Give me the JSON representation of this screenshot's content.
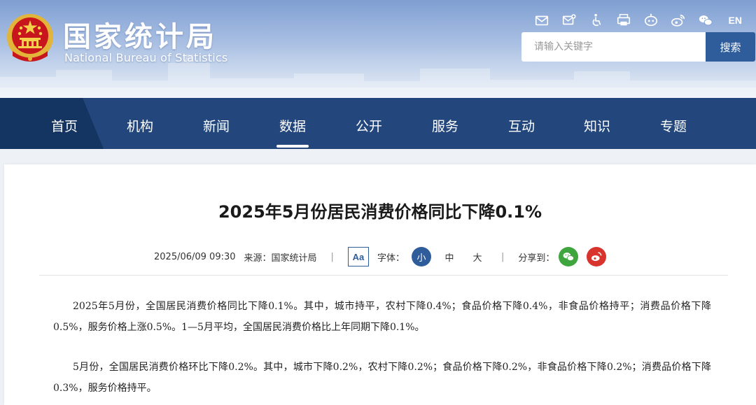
{
  "header": {
    "site_name_cn": "国家统计局",
    "site_name_en": "National Bureau of Statistics",
    "tools": [
      {
        "name": "mail-icon"
      },
      {
        "name": "subscribe-icon"
      },
      {
        "name": "accessibility-icon"
      },
      {
        "name": "print-icon"
      },
      {
        "name": "robot-icon"
      },
      {
        "name": "weibo-icon"
      },
      {
        "name": "wechat-icon"
      }
    ],
    "lang_label": "EN",
    "search": {
      "placeholder": "请输入关键字",
      "value": "",
      "button_label": "搜索"
    }
  },
  "nav": {
    "items": [
      {
        "label": "首页"
      },
      {
        "label": "机构"
      },
      {
        "label": "新闻"
      },
      {
        "label": "数据",
        "active": true
      },
      {
        "label": "公开"
      },
      {
        "label": "服务"
      },
      {
        "label": "互动"
      },
      {
        "label": "知识"
      },
      {
        "label": "专题"
      }
    ]
  },
  "article": {
    "title": "2025年5月份居民消费价格同比下降0.1%",
    "date": "2025/06/09 09:30",
    "source": "来源：国家统计局",
    "font_badge": "Aa",
    "font_label": "字体：",
    "font_sizes": [
      "小",
      "中",
      "大"
    ],
    "share_label": "分享到：",
    "separator": "|",
    "paragraphs": [
      "2025年5月份，全国居民消费价格同比下降0.1%。其中，城市持平，农村下降0.4%；食品价格下降0.4%，非食品价格持平；消费品价格下降0.5%，服务价格上涨0.5%。1—5月平均，全国居民消费价格比上年同期下降0.1%。",
      "5月份，全国居民消费价格环比下降0.2%。其中，城市下降0.2%，农村下降0.2%；食品价格下降0.2%，非食品价格下降0.2%；消费品价格下降0.3%，服务价格持平。"
    ]
  },
  "colors": {
    "nav_bg": "#23477d",
    "nav_home_bg": "#143461",
    "accent": "#2f5d9c",
    "wechat_green": "#3fa63f",
    "weibo_red": "#d8332c"
  }
}
